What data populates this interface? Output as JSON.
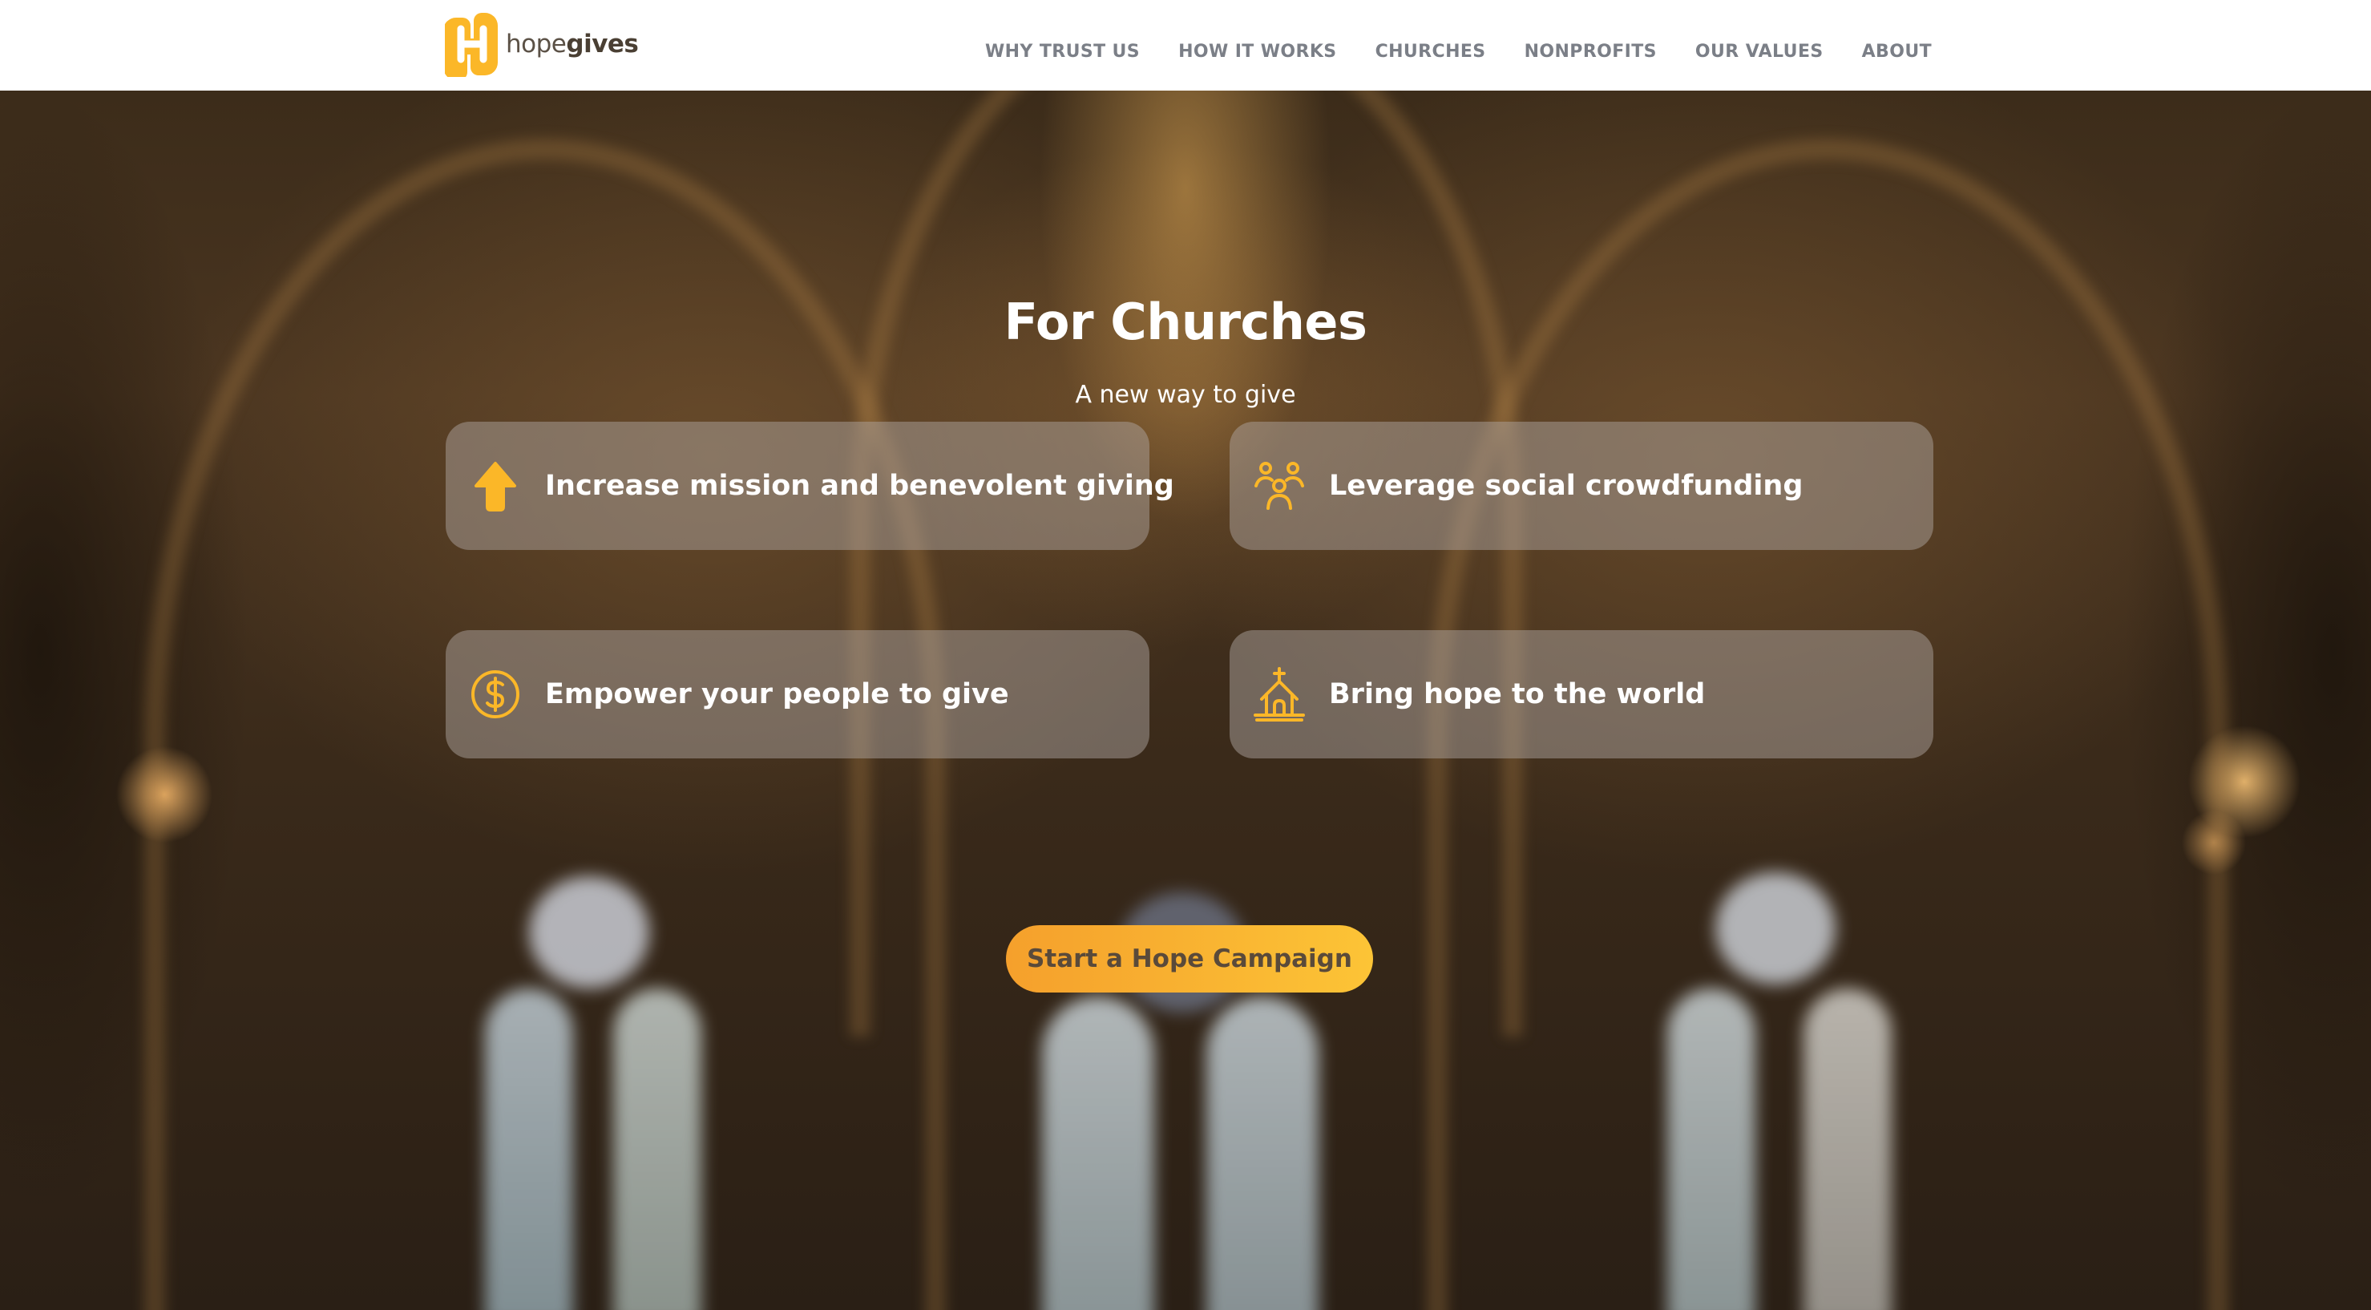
{
  "brand": {
    "logo_light": "hope",
    "logo_bold": "gives",
    "accent_color": "#FBB728"
  },
  "nav": {
    "items": [
      {
        "label": "WHY TRUST US"
      },
      {
        "label": "HOW IT WORKS"
      },
      {
        "label": "CHURCHES"
      },
      {
        "label": "NONPROFITS"
      },
      {
        "label": "OUR VALUES"
      },
      {
        "label": "ABOUT"
      }
    ]
  },
  "hero": {
    "title": "For Churches",
    "subtitle": "A new way to give",
    "background": "blurred church interior",
    "cards": [
      {
        "label": "Increase mission and benevolent giving",
        "icon": "arrow-up-icon"
      },
      {
        "label": "Leverage social crowdfunding",
        "icon": "people-group-icon"
      },
      {
        "label": "Empower your people to give",
        "icon": "dollar-coin-icon"
      },
      {
        "label": "Bring hope to the world",
        "icon": "church-icon"
      }
    ],
    "cta_label": "Start a Hope Campaign"
  }
}
